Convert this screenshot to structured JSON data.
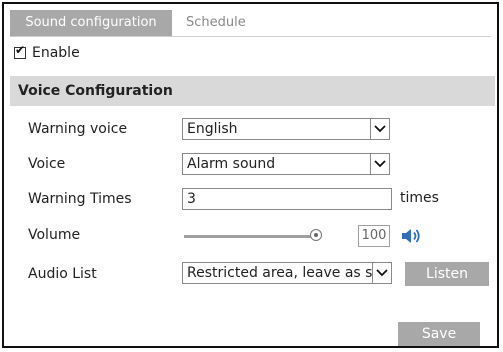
{
  "tabs": [
    {
      "label": "Sound configuration",
      "active": true
    },
    {
      "label": "Schedule",
      "active": false
    }
  ],
  "enable": {
    "label": "Enable",
    "checked": true
  },
  "section": {
    "title": "Voice Configuration"
  },
  "warning_voice": {
    "label": "Warning voice",
    "value": "English"
  },
  "voice": {
    "label": "Voice",
    "value": "Alarm sound"
  },
  "warning_times": {
    "label": "Warning Times",
    "value": "3",
    "unit": "times"
  },
  "volume": {
    "label": "Volume",
    "value": "100",
    "level_percent": 100
  },
  "audio_list": {
    "label": "Audio List",
    "value": "Restricted area, leave as so"
  },
  "buttons": {
    "listen": "Listen",
    "save": "Save"
  },
  "colors": {
    "tab_active": "#a8a8a8",
    "header_bg": "#d9d9d9",
    "button_bg": "#a8a8a8",
    "speaker": "#2f6fb5"
  }
}
